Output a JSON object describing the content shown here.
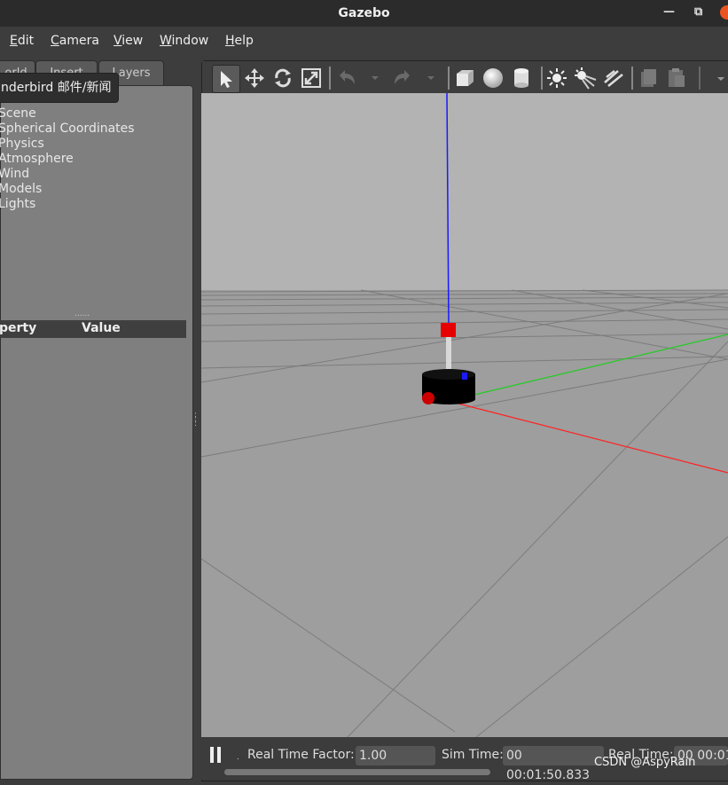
{
  "window": {
    "title": "Gazebo"
  },
  "menu": [
    {
      "label": "Edit",
      "u": "E",
      "rest": "dit"
    },
    {
      "label": "Camera",
      "u": "C",
      "rest": "amera"
    },
    {
      "label": "View",
      "u": "V",
      "rest": "iew"
    },
    {
      "label": "Window",
      "u": "W",
      "rest": "indow"
    },
    {
      "label": "Help",
      "u": "H",
      "rest": "elp"
    }
  ],
  "left_tabs": [
    "orld",
    "Insert",
    "Layers"
  ],
  "tooltip": "nderbird 邮件/新闻",
  "tree": [
    "Scene",
    "Spherical Coordinates",
    "Physics",
    "Atmosphere",
    "Wind",
    "Models",
    "Lights"
  ],
  "grip": "......",
  "props": {
    "col1": "perty",
    "col2": "Value"
  },
  "toolbar_icons": [
    "select-arrow-icon",
    "translate-icon",
    "rotate-icon",
    "scale-icon",
    "undo-icon",
    "redo-icon",
    "box-icon",
    "sphere-icon",
    "cylinder-icon",
    "point-light-icon",
    "spot-light-icon",
    "directional-light-icon",
    "copy-icon",
    "paste-icon"
  ],
  "status": {
    "rtf_label": "Real Time Factor:",
    "rtf_value": "1.00",
    "sim_label": "Sim Time:",
    "sim_value": "00 00:01:50.833",
    "real_label": "Real Time:",
    "real_value": "00 00:01"
  },
  "watermark": "CSDN @AspyRain",
  "colors": {
    "z_axis": "#1a1aff",
    "y_axis": "#22cc22",
    "x_axis": "#ff2222",
    "robot": "#000000",
    "marker": "#e60000"
  }
}
